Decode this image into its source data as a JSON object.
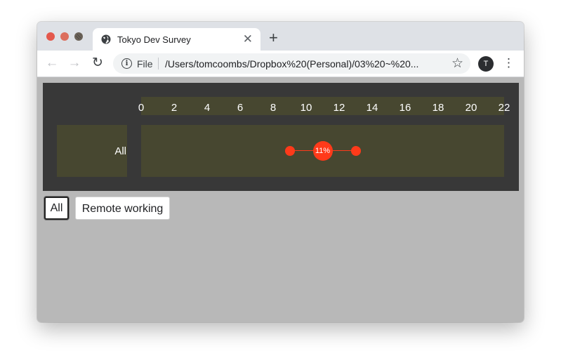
{
  "window": {
    "tab": {
      "title": "Tokyo Dev Survey",
      "favicon": "globe-icon",
      "close": "✕"
    },
    "new_tab": "+",
    "toolbar": {
      "back": "←",
      "forward": "→",
      "reload": "↻",
      "info": "i",
      "scheme_label": "File",
      "url": "/Users/tomcoombs/Dropbox%20(Personal)/03%20~%20...",
      "star": "☆",
      "avatar": "T",
      "menu": "⋮"
    }
  },
  "chart_data": {
    "type": "scatter",
    "x_ticks": [
      "0",
      "2",
      "4",
      "6",
      "8",
      "10",
      "12",
      "14",
      "16",
      "18",
      "20",
      "22"
    ],
    "xlim": [
      0,
      22
    ],
    "rows": [
      {
        "label": "All",
        "low": 9,
        "value": 11,
        "high": 13,
        "value_label": "11%"
      }
    ],
    "colors": {
      "marker": "#ff3a1a",
      "panel": "#383838",
      "band": "#474730"
    }
  },
  "filters": {
    "all_label": "All",
    "remote_label": "Remote working",
    "selected": "All"
  }
}
